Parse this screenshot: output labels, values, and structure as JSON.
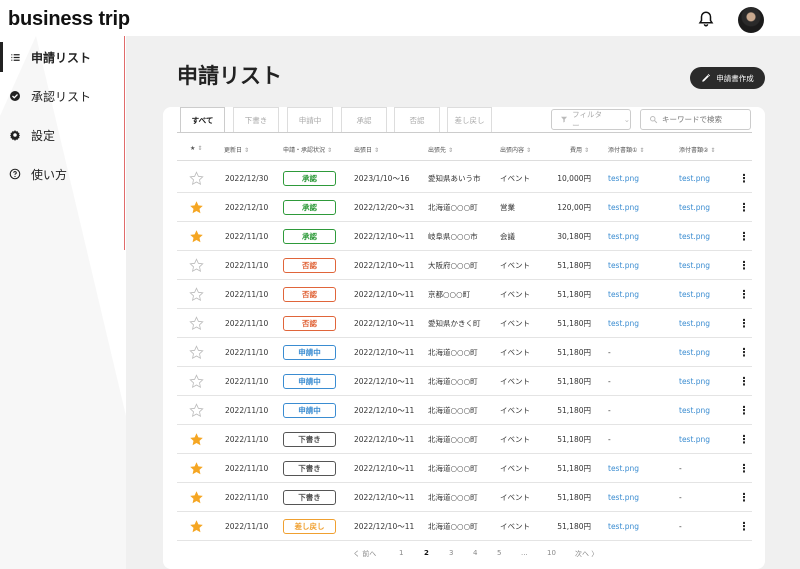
{
  "app": {
    "title": "business trip"
  },
  "sidebar": {
    "items": [
      {
        "label": "申請リスト",
        "icon": "list-icon",
        "active": true
      },
      {
        "label": "承認リスト",
        "icon": "check-circle-icon",
        "active": false
      },
      {
        "label": "設定",
        "icon": "gear-icon",
        "active": false
      },
      {
        "label": "使い方",
        "icon": "help-icon",
        "active": false
      }
    ]
  },
  "main": {
    "title": "申請リスト",
    "create_button": "申請書作成"
  },
  "tabs": [
    "すべて",
    "下書き",
    "申請中",
    "承認",
    "否認",
    "差し戻し"
  ],
  "filter": {
    "label": "フィルター"
  },
  "search": {
    "placeholder": "キーワードで検索"
  },
  "table": {
    "headers": [
      "★",
      "更新日",
      "申請・承認状況",
      "出張日",
      "出張先",
      "出張内容",
      "費用",
      "添付書類①",
      "添付書類②"
    ],
    "rows": [
      {
        "star": false,
        "updated": "2022/12/30",
        "status": "承認",
        "trip_date": "2023/1/10〜16",
        "dest": "愛知県あいう市",
        "purpose": "イベント",
        "cost": "10,000円",
        "att1": "test.png",
        "att2": "test.png"
      },
      {
        "star": true,
        "updated": "2022/12/10",
        "status": "承認",
        "trip_date": "2022/12/20〜31",
        "dest": "北海道○○○町",
        "purpose": "営業",
        "cost": "120,00円",
        "att1": "test.png",
        "att2": "test.png"
      },
      {
        "star": true,
        "updated": "2022/11/10",
        "status": "承認",
        "trip_date": "2022/12/10〜11",
        "dest": "岐阜県○○○市",
        "purpose": "会議",
        "cost": "30,180円",
        "att1": "test.png",
        "att2": "test.png"
      },
      {
        "star": false,
        "updated": "2022/11/10",
        "status": "否認",
        "trip_date": "2022/12/10〜11",
        "dest": "大阪府○○○町",
        "purpose": "イベント",
        "cost": "51,180円",
        "att1": "test.png",
        "att2": "test.png"
      },
      {
        "star": false,
        "updated": "2022/11/10",
        "status": "否認",
        "trip_date": "2022/12/10〜11",
        "dest": "京都○○○町",
        "purpose": "イベント",
        "cost": "51,180円",
        "att1": "test.png",
        "att2": "test.png"
      },
      {
        "star": false,
        "updated": "2022/11/10",
        "status": "否認",
        "trip_date": "2022/12/10〜11",
        "dest": "愛知県かきく町",
        "purpose": "イベント",
        "cost": "51,180円",
        "att1": "test.png",
        "att2": "test.png"
      },
      {
        "star": false,
        "updated": "2022/11/10",
        "status": "申請中",
        "trip_date": "2022/12/10〜11",
        "dest": "北海道○○○町",
        "purpose": "イベント",
        "cost": "51,180円",
        "att1": "-",
        "att2": "test.png"
      },
      {
        "star": false,
        "updated": "2022/11/10",
        "status": "申請中",
        "trip_date": "2022/12/10〜11",
        "dest": "北海道○○○町",
        "purpose": "イベント",
        "cost": "51,180円",
        "att1": "-",
        "att2": "test.png"
      },
      {
        "star": false,
        "updated": "2022/11/10",
        "status": "申請中",
        "trip_date": "2022/12/10〜11",
        "dest": "北海道○○○町",
        "purpose": "イベント",
        "cost": "51,180円",
        "att1": "-",
        "att2": "test.png"
      },
      {
        "star": true,
        "updated": "2022/11/10",
        "status": "下書き",
        "trip_date": "2022/12/10〜11",
        "dest": "北海道○○○町",
        "purpose": "イベント",
        "cost": "51,180円",
        "att1": "-",
        "att2": "test.png"
      },
      {
        "star": true,
        "updated": "2022/11/10",
        "status": "下書き",
        "trip_date": "2022/12/10〜11",
        "dest": "北海道○○○町",
        "purpose": "イベント",
        "cost": "51,180円",
        "att1": "test.png",
        "att2": "-"
      },
      {
        "star": true,
        "updated": "2022/11/10",
        "status": "下書き",
        "trip_date": "2022/12/10〜11",
        "dest": "北海道○○○町",
        "purpose": "イベント",
        "cost": "51,180円",
        "att1": "test.png",
        "att2": "-"
      },
      {
        "star": true,
        "updated": "2022/11/10",
        "status": "差し戻し",
        "trip_date": "2022/12/10〜11",
        "dest": "北海道○○○町",
        "purpose": "イベント",
        "cost": "51,180円",
        "att1": "test.png",
        "att2": "-"
      }
    ]
  },
  "status_colors": {
    "承認": "#2e9a3a",
    "否認": "#e0653a",
    "申請中": "#3a8cd1",
    "下書き": "#555555",
    "差し戻し": "#f0a030"
  },
  "star_color": "#f5a623",
  "pagination": {
    "prev": "く 前へ",
    "pages": [
      "1",
      "2",
      "3",
      "4",
      "5",
      "...",
      "10"
    ],
    "current": "2",
    "next": "次へ 〉"
  }
}
